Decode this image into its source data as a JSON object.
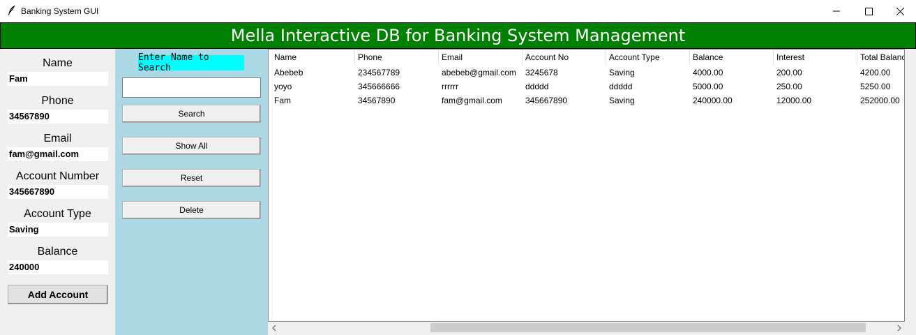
{
  "window": {
    "title": "Banking System GUI"
  },
  "banner": {
    "title": "Mella Interactive DB for Banking System Management"
  },
  "form": {
    "fields": [
      {
        "label": "Name",
        "value": "Fam"
      },
      {
        "label": "Phone",
        "value": "34567890"
      },
      {
        "label": "Email",
        "value": "fam@gmail.com"
      },
      {
        "label": "Account Number",
        "value": "345667890"
      },
      {
        "label": "Account Type",
        "value": "Saving"
      },
      {
        "label": "Balance",
        "value": "240000"
      }
    ],
    "add_button": "Add Account"
  },
  "search": {
    "label": "Enter Name to Search",
    "value": "",
    "buttons": [
      "Search",
      "Show All",
      "Reset",
      "Delete"
    ]
  },
  "table": {
    "columns": [
      "Name",
      "Phone",
      "Email",
      "Account No",
      "Account Type",
      "Balance",
      "Interest",
      "Total Balance"
    ],
    "rows": [
      [
        "Abebeb",
        "234567789",
        "abebeb@gmail.com",
        "3245678",
        "Saving",
        "4000.00",
        "200.00",
        "4200.00"
      ],
      [
        "yoyo",
        "345666666",
        "rrrrrr",
        "ddddd",
        "ddddd",
        "5000.00",
        "250.00",
        "5250.00"
      ],
      [
        "Fam",
        "34567890",
        "fam@gmail.com",
        "345667890",
        "Saving",
        "240000.00",
        "12000.00",
        "252000.00"
      ]
    ]
  },
  "colors": {
    "banner_bg": "#008000",
    "search_panel_bg": "#add8e6",
    "search_label_bg": "#00ffff"
  }
}
